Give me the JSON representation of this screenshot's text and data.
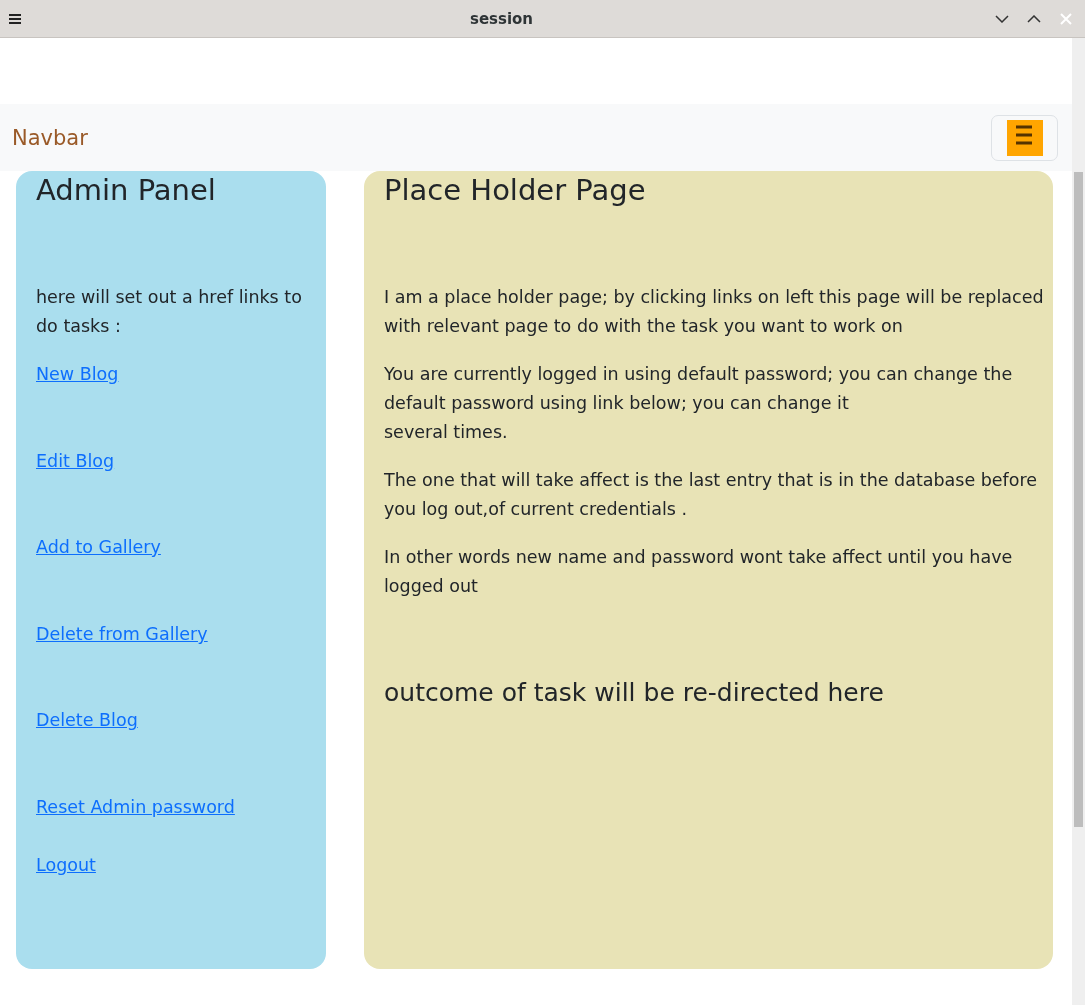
{
  "window": {
    "title": "session"
  },
  "navbar": {
    "brand": "Navbar"
  },
  "sidebar": {
    "title": "Admin Panel",
    "intro": "here will set out a href links to do tasks :",
    "links": [
      {
        "label": "New Blog"
      },
      {
        "label": "Edit Blog"
      },
      {
        "label": "Add to Gallery"
      },
      {
        "label": "Delete from Gallery"
      },
      {
        "label": "Delete Blog"
      },
      {
        "label": "Reset Admin password"
      },
      {
        "label": "Logout"
      }
    ]
  },
  "main": {
    "title": "Place Holder Page",
    "paragraphs": [
      "I am a place holder page; by clicking links on left this page will be replaced with relevant page to do with the task you want to work on",
      "You are currently logged in using default password; you can change the default password using link below; you can change it\nseveral times.",
      "The one that will take affect is the last entry that is in the database before you log out,of current credentials .",
      "In other words new name and password wont take affect until you have logged out"
    ],
    "outcome": "outcome of task will be re-directed here"
  }
}
